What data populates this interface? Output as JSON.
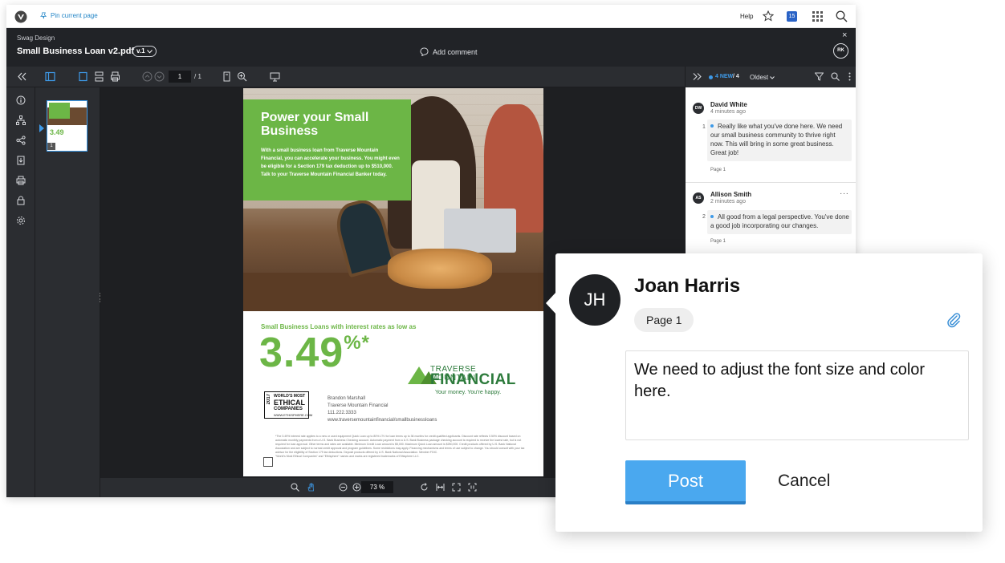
{
  "topbar": {
    "pin_label": "Pin current page",
    "help_label": "Help",
    "notification_count": "15",
    "icons": [
      "logo-icon",
      "pin-icon",
      "star-icon",
      "apps-grid-icon",
      "search-icon"
    ]
  },
  "doc_header": {
    "project": "Swag Design",
    "filename": "Small Business Loan v2.pdf",
    "version": "v.1",
    "add_comment": "Add comment",
    "close_glyph": "×",
    "user_initials": "RK"
  },
  "toolbar": {
    "current_page": "1",
    "page_total": "/ 1"
  },
  "viewer": {
    "zoom": "73 %",
    "thumb_page_number": "1"
  },
  "document": {
    "headline": "Power your Small Business",
    "intro": "With a small business loan from Traverse Mountain Financial, you can accelerate your business. You might even be eligible for a Section 179 tax deduction up to $510,000. Talk to your Traverse Mountain Financial Banker today.",
    "rates_label": "Small Business Loans with interest rates as low as",
    "rate_value": "3.49",
    "rate_suffix": "%*",
    "brand_top": "TRAVERSE MOUNTAIN",
    "brand_main": "FINANCIAL",
    "brand_tagline": "Your money. You're happy.",
    "ethical_year": "2017",
    "ethical_line1": "WORLD'S MOST",
    "ethical_line2": "ETHICAL",
    "ethical_line3": "COMPANIES",
    "ethical_site": "WWW.ETHISPHERE.COM",
    "contact_name": "Brandon Marshall",
    "contact_company": "Traverse Mountain Financial",
    "contact_phone": "111.222.3333",
    "contact_url": "www.traversemountainfinancial/smallbusinessloans",
    "fineprint": "*The 3.49% interest rate applies to a new or used equipment Quick Loan up to 80% LTV for loan terms up to 36 months for credit qualified applicants. Discount rate reflects 0.50% discount based on automatic monthly payments from a U.S. Bank Business Checking account. Automatic payment from a U.S. Bank Business package checking account is required to receive the lowest rate, but is not required for loan approval. Other terms and rates are available. Minimum Credit Loan amount is $5,000. Maximum Quick Loan amount is $250,000. Credit products offered by U.S. Bank National Association and are subject to normal credit approval and program guidelines. Some restrictions may apply. Financing mechanisms and terms of use subject to change. You should consult with your tax advisor for the eligibility of Section 179 tax deductions. Deposit products offered by U.S. Bank National Association. Member FDIC.",
    "fineprint_footer": "\"World's Most Ethical Companies\" and \"Ethisphere\" names and marks are registered trademarks of Ethisphere LLC."
  },
  "comments_panel": {
    "new_count": "4 NEW",
    "total": "/ 4",
    "sort": "Oldest",
    "comments": [
      {
        "initials": "DW",
        "author": "David White",
        "time": "4 minutes ago",
        "number": "1",
        "text": "Really like what you've done here. We need our small business community to thrive right now. This will bring in some great business. Great job!",
        "page": "Page 1"
      },
      {
        "initials": "AS",
        "author": "Allison Smith",
        "time": "2 minutes ago",
        "number": "2",
        "text": "All good from a legal perspective. You've done a good job incorporating our changes.",
        "page": "Page 1",
        "more": "···"
      }
    ]
  },
  "popup": {
    "initials": "JH",
    "name": "Joan Harris",
    "page_chip": "Page 1",
    "comment_text": "We need to adjust the font size and color here.",
    "post_label": "Post",
    "cancel_label": "Cancel"
  },
  "colors": {
    "brand_green": "#6cb646",
    "accent_blue": "#4aa8ef",
    "dark_chrome": "#2b2d31"
  }
}
